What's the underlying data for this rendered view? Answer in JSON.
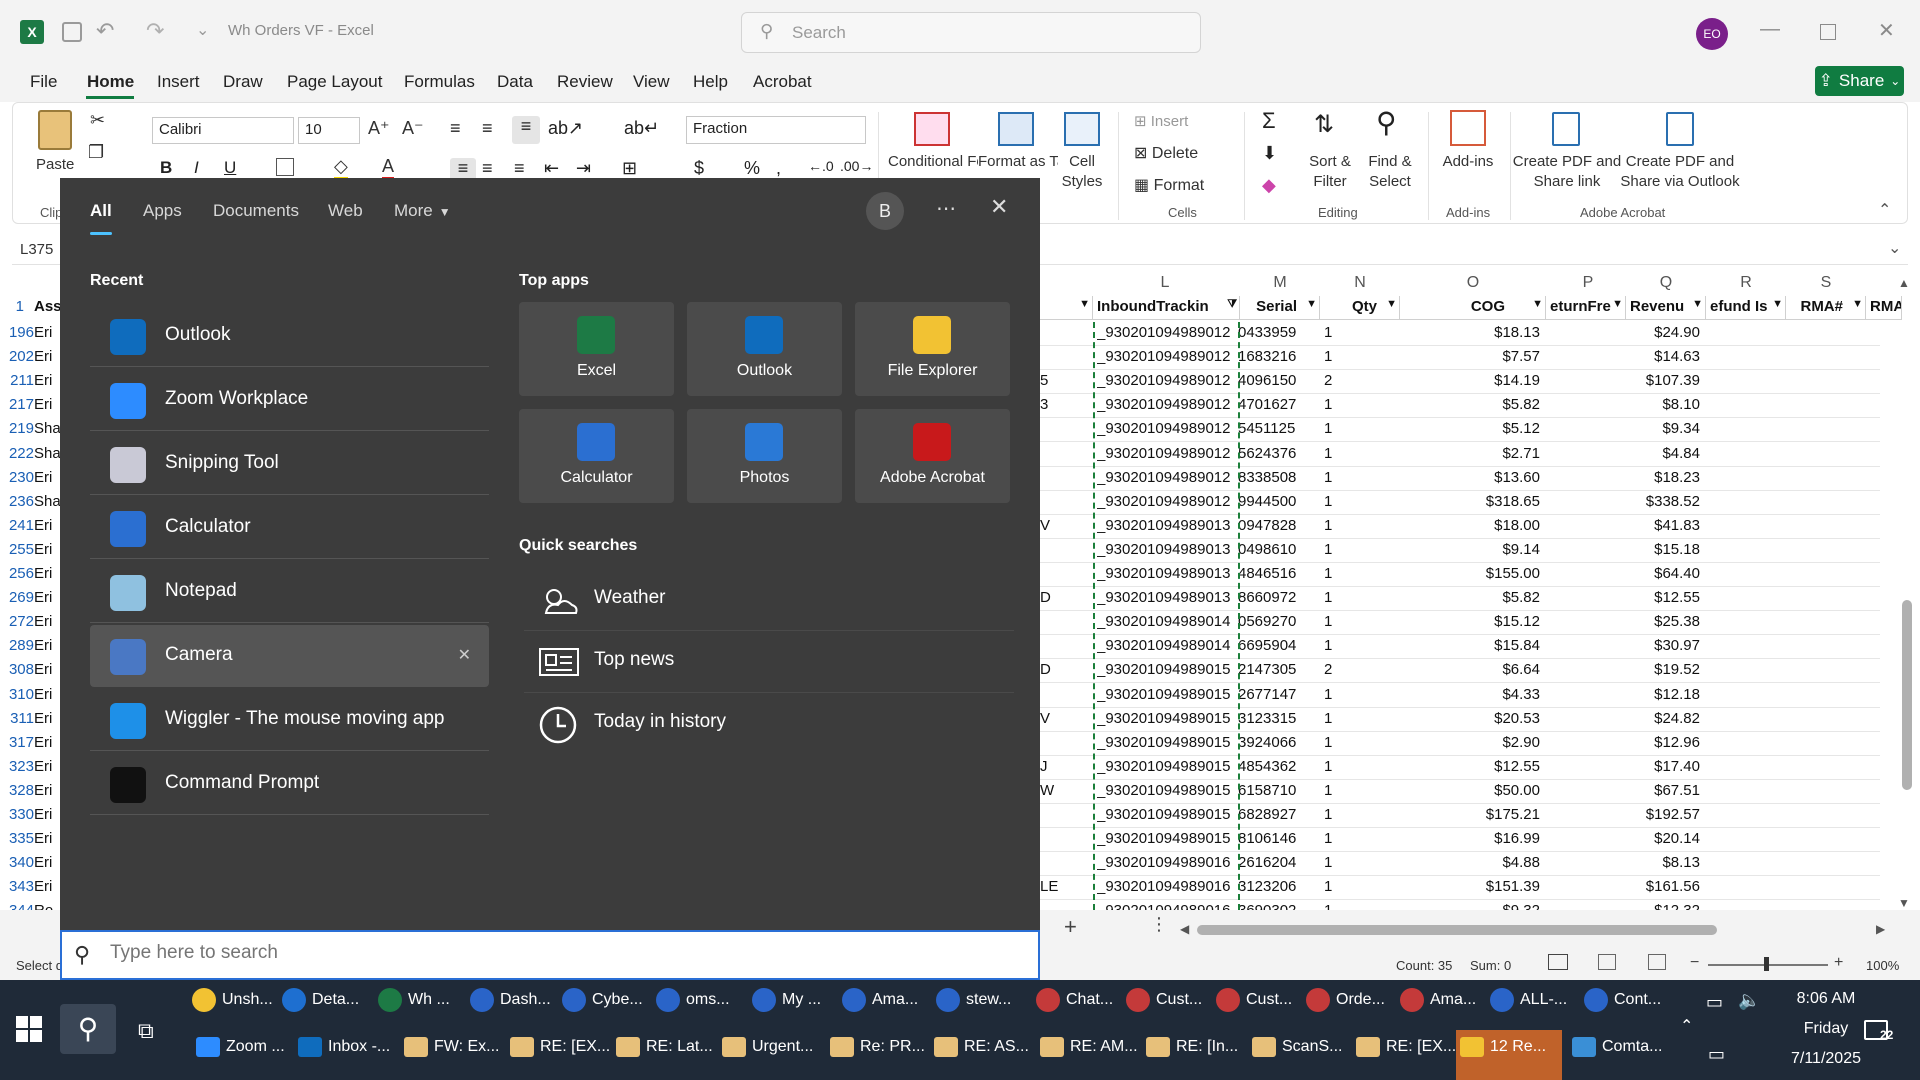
{
  "window": {
    "title": "Wh Orders VF  -  Excel",
    "search_placeholder": "Search",
    "avatar": "EO"
  },
  "menu_tabs": [
    "File",
    "Home",
    "Insert",
    "Draw",
    "Page Layout",
    "Formulas",
    "Data",
    "Review",
    "View",
    "Help",
    "Acrobat"
  ],
  "share_label": "Share",
  "ribbon": {
    "paste": "Paste",
    "clipboard_group": "Clip",
    "font_name": "Calibri",
    "font_size": "10",
    "number_format": "Fraction",
    "conditional_formatting": "Conditional Formatting",
    "format_as_table": "Format as Table",
    "cell_styles": "Cell Styles",
    "insert": "Insert",
    "delete": "Delete",
    "format": "Format",
    "cells_group": "Cells",
    "sort_filter": "Sort & Filter",
    "find_select": "Find & Select",
    "editing_group": "Editing",
    "add_ins": "Add-ins",
    "add_ins_group": "Add-ins",
    "create_pdf_share": "Create PDF and Share link",
    "create_pdf_outlook": "Create PDF and Share via Outlook",
    "adobe_group": "Adobe Acrobat"
  },
  "name_box": "L375",
  "columns": {
    "L": "L",
    "M": "M",
    "N": "N",
    "O": "O",
    "P": "P",
    "Q": "Q",
    "R": "R",
    "S": "S"
  },
  "headers": {
    "row_label": "1",
    "A": "Ass",
    "L": "InboundTrackin",
    "M": "Serial",
    "N": "Qty",
    "O": "COG",
    "P": "eturnFre",
    "Q": "Revenu",
    "R": "efund Is",
    "S": "RMA#",
    "T": "RMA"
  },
  "rows": [
    {
      "row": "196",
      "a": "Eri",
      "k": "",
      "l": "_930201094989012",
      "m": "0433959",
      "n": "1",
      "o": "$18.13",
      "q": "$24.90"
    },
    {
      "row": "202",
      "a": "Eri",
      "k": "",
      "l": "_930201094989012",
      "m": "1683216",
      "n": "1",
      "o": "$7.57",
      "q": "$14.63"
    },
    {
      "row": "211",
      "a": "Eri",
      "k": "5",
      "l": "_930201094989012",
      "m": "4096150",
      "n": "2",
      "o": "$14.19",
      "q": "$107.39"
    },
    {
      "row": "217",
      "a": "Eri",
      "k": "3",
      "l": "_930201094989012",
      "m": "4701627",
      "n": "1",
      "o": "$5.82",
      "q": "$8.10"
    },
    {
      "row": "219",
      "a": "Sha",
      "k": "",
      "l": "_930201094989012",
      "m": "5451125",
      "n": "1",
      "o": "$5.12",
      "q": "$9.34"
    },
    {
      "row": "222",
      "a": "Sha",
      "k": "",
      "l": "_930201094989012",
      "m": "5624376",
      "n": "1",
      "o": "$2.71",
      "q": "$4.84"
    },
    {
      "row": "230",
      "a": "Eri",
      "k": "",
      "l": "_930201094989012",
      "m": "8338508",
      "n": "1",
      "o": "$13.60",
      "q": "$18.23"
    },
    {
      "row": "236",
      "a": "Sha",
      "k": "",
      "l": "_930201094989012",
      "m": "9944500",
      "n": "1",
      "o": "$318.65",
      "q": "$338.52"
    },
    {
      "row": "241",
      "a": "Eri",
      "k": "V",
      "l": "_930201094989013",
      "m": "0947828",
      "n": "1",
      "o": "$18.00",
      "q": "$41.83"
    },
    {
      "row": "255",
      "a": "Eri",
      "k": "",
      "l": "_930201094989013",
      "m": "0498610",
      "n": "1",
      "o": "$9.14",
      "q": "$15.18"
    },
    {
      "row": "256",
      "a": "Eri",
      "k": "",
      "l": "_930201094989013",
      "m": "4846516",
      "n": "1",
      "o": "$155.00",
      "q": "$64.40"
    },
    {
      "row": "269",
      "a": "Eri",
      "k": "D",
      "l": "_930201094989013",
      "m": "8660972",
      "n": "1",
      "o": "$5.82",
      "q": "$12.55"
    },
    {
      "row": "272",
      "a": "Eri",
      "k": "",
      "l": "_930201094989014",
      "m": "0569270",
      "n": "1",
      "o": "$15.12",
      "q": "$25.38"
    },
    {
      "row": "289",
      "a": "Eri",
      "k": "",
      "l": "_930201094989014",
      "m": "6695904",
      "n": "1",
      "o": "$15.84",
      "q": "$30.97"
    },
    {
      "row": "308",
      "a": "Eri",
      "k": "D",
      "l": "_930201094989015",
      "m": "2147305",
      "n": "2",
      "o": "$6.64",
      "q": "$19.52"
    },
    {
      "row": "310",
      "a": "Eri",
      "k": "",
      "l": "_930201094989015",
      "m": "2677147",
      "n": "1",
      "o": "$4.33",
      "q": "$12.18"
    },
    {
      "row": "311",
      "a": "Eri",
      "k": "V",
      "l": "_930201094989015",
      "m": "3123315",
      "n": "1",
      "o": "$20.53",
      "q": "$24.82"
    },
    {
      "row": "317",
      "a": "Eri",
      "k": "",
      "l": "_930201094989015",
      "m": "3924066",
      "n": "1",
      "o": "$2.90",
      "q": "$12.96"
    },
    {
      "row": "323",
      "a": "Eri",
      "k": "J",
      "l": "_930201094989015",
      "m": "4854362",
      "n": "1",
      "o": "$12.55",
      "q": "$17.40"
    },
    {
      "row": "328",
      "a": "Eri",
      "k": "W",
      "l": "_930201094989015",
      "m": "6158710",
      "n": "1",
      "o": "$50.00",
      "q": "$67.51"
    },
    {
      "row": "330",
      "a": "Eri",
      "k": "",
      "l": "_930201094989015",
      "m": "6828927",
      "n": "1",
      "o": "$175.21",
      "q": "$192.57"
    },
    {
      "row": "335",
      "a": "Eri",
      "k": "",
      "l": "_930201094989015",
      "m": "8106146",
      "n": "1",
      "o": "$16.99",
      "q": "$20.14"
    },
    {
      "row": "340",
      "a": "Eri",
      "k": "",
      "l": "_930201094989016",
      "m": "2616204",
      "n": "1",
      "o": "$4.88",
      "q": "$8.13"
    },
    {
      "row": "343",
      "a": "Eri",
      "k": "LE",
      "l": "_930201094989016",
      "m": "3123206",
      "n": "1",
      "o": "$151.39",
      "q": "$161.56"
    },
    {
      "row": "344",
      "a": "Ro",
      "k": "",
      "l": "_930201094989016",
      "m": "3690302",
      "n": "1",
      "o": "$9.32",
      "q": "$12.32"
    }
  ],
  "status": {
    "left": "Select d",
    "count": "Count: 35",
    "sum": "Sum: 0",
    "zoom": "100%"
  },
  "start_menu": {
    "tabs": [
      "All",
      "Apps",
      "Documents",
      "Web",
      "More"
    ],
    "avatar": "B",
    "recent_title": "Recent",
    "recent": [
      {
        "label": "Outlook",
        "icon": "outlook-icon",
        "color": "#0f6cbd"
      },
      {
        "label": "Zoom Workplace",
        "icon": "zoom-icon",
        "color": "#2d8cff"
      },
      {
        "label": "Snipping Tool",
        "icon": "snipping-tool-icon",
        "color": "#c9c9d6"
      },
      {
        "label": "Calculator",
        "icon": "calculator-icon",
        "color": "#2b6fd1"
      },
      {
        "label": "Notepad",
        "icon": "notepad-icon",
        "color": "#8fc1e0"
      },
      {
        "label": "Camera",
        "icon": "camera-icon",
        "color": "#4a78c4"
      },
      {
        "label": "Wiggler - The mouse moving app",
        "icon": "wiggler-icon",
        "color": "#1e90e8"
      },
      {
        "label": "Command Prompt",
        "icon": "command-prompt-icon",
        "color": "#111111"
      }
    ],
    "top_apps_title": "Top apps",
    "top_apps": [
      {
        "label": "Excel",
        "icon": "excel-icon",
        "color": "#1d7a45"
      },
      {
        "label": "Outlook",
        "icon": "outlook-icon",
        "color": "#0f6cbd"
      },
      {
        "label": "File Explorer",
        "icon": "file-explorer-icon",
        "color": "#f2c233"
      },
      {
        "label": "Calculator",
        "icon": "calculator-icon",
        "color": "#2b6fd1"
      },
      {
        "label": "Photos",
        "icon": "photos-icon",
        "color": "#2a79d6"
      },
      {
        "label": "Adobe Acrobat",
        "icon": "adobe-acrobat-icon",
        "color": "#c8191b"
      }
    ],
    "quick_searches_title": "Quick searches",
    "quick_searches": [
      {
        "label": "Weather",
        "icon": "weather-icon"
      },
      {
        "label": "Top news",
        "icon": "news-icon"
      },
      {
        "label": "Today in history",
        "icon": "clock-icon"
      }
    ],
    "search_placeholder": "Type here to search"
  },
  "taskbar": {
    "row1": [
      "Unsh...",
      "Deta...",
      "Wh ...",
      "Dash...",
      "Cybe...",
      "oms...",
      "My ...",
      "Ama...",
      "stew...",
      "Chat...",
      "Cust...",
      "Cust...",
      "Orde...",
      "Ama...",
      "ALL-...",
      "Cont..."
    ],
    "row2": [
      "Zoom ...",
      "Inbox -...",
      "FW: Ex...",
      "RE: [EX...",
      "RE: Lat...",
      "Urgent...",
      "Re: PR...",
      "RE: AS...",
      "RE: AM...",
      "RE: [In...",
      "ScanS...",
      "RE: [EX...",
      "12 Re...",
      "Comta..."
    ],
    "time": "8:06 AM",
    "day": "Friday",
    "date": "7/11/2025",
    "notifications": "22"
  }
}
